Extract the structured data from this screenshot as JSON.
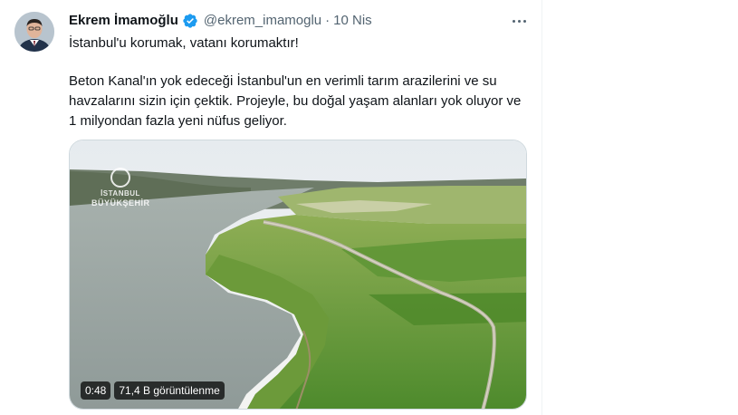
{
  "tweet": {
    "author_name": "Ekrem İmamoğlu",
    "handle": "@ekrem_imamoglu",
    "separator": "·",
    "date": "10 Nis",
    "paragraph1": "İstanbul'u korumak, vatanı korumaktır!",
    "paragraph2": "Beton Kanal'ın yok edeceği İstanbul'un en verimli tarım arazilerini ve su havzalarını sizin için çektik. Projeyle, bu doğal yaşam alanları yok oluyor ve 1 milyondan fazla yeni nüfus geliyor."
  },
  "video": {
    "duration": "0:48",
    "views": "71,4 B görüntülenme",
    "watermark_line1": "İSTANBUL",
    "watermark_line2": "BÜYÜKŞEHİR"
  },
  "icons": {
    "verified": "verified-badge-icon",
    "more": "more-options-icon"
  },
  "colors": {
    "verified": "#1d9bf0",
    "secondary_text": "#536471"
  }
}
